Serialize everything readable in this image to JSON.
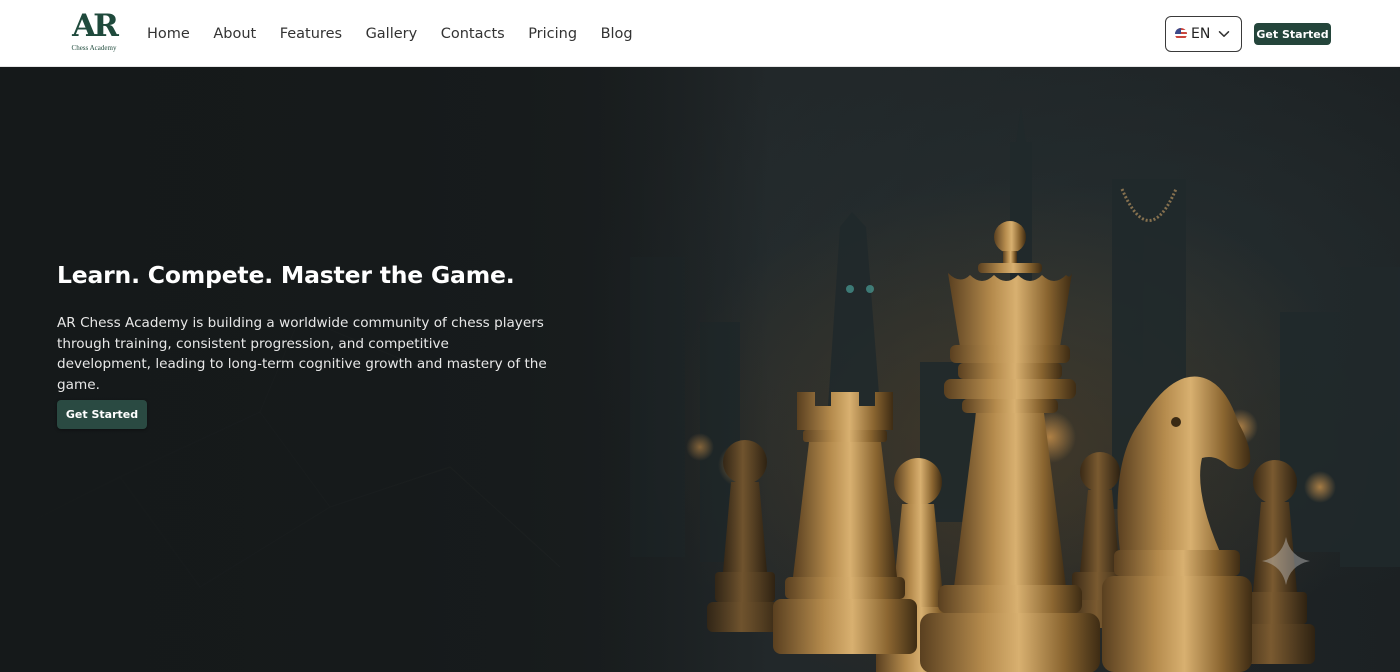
{
  "brand": {
    "logo_mark": "AR",
    "logo_sub": "Chess Academy"
  },
  "nav": {
    "items": [
      {
        "label": "Home"
      },
      {
        "label": "About"
      },
      {
        "label": "Features"
      },
      {
        "label": "Gallery"
      },
      {
        "label": "Contacts"
      },
      {
        "label": "Pricing"
      },
      {
        "label": "Blog"
      }
    ]
  },
  "language": {
    "selected": "EN",
    "flag_icon": "us-flag-icon"
  },
  "header": {
    "cta_label": "Get Started"
  },
  "hero": {
    "title": "Learn. Compete. Master the Game.",
    "description": "AR Chess Academy is building a worldwide community of chess players through training, consistent progression, and competitive development, leading to long-term cognitive growth and mastery of the game.",
    "cta_label": "Get Started",
    "background_icon": "chess-pieces-skyline-image"
  },
  "colors": {
    "brand_green": "#24453b",
    "hero_button": "#2a4a42",
    "gold": "#b08a4e"
  }
}
